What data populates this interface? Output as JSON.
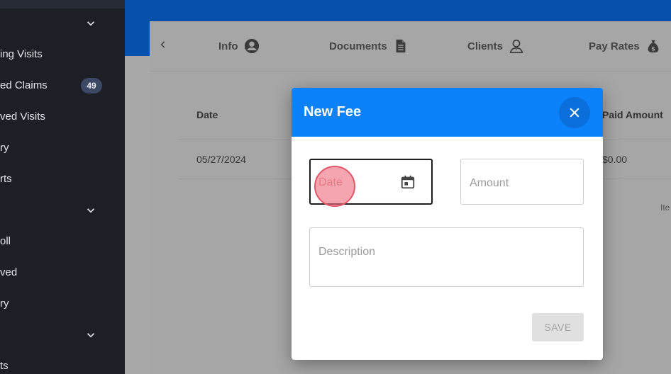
{
  "sidebar": {
    "items": [
      {
        "label": "ing Visits"
      },
      {
        "label": "ed Claims",
        "badge": "49"
      },
      {
        "label": "ved Visits"
      },
      {
        "label": "ry"
      },
      {
        "label": "rts"
      },
      {
        "label": "oll"
      },
      {
        "label": "ved"
      },
      {
        "label": "ry"
      },
      {
        "label": "ts"
      }
    ]
  },
  "tabs": [
    {
      "label": "Info",
      "icon": "account-circle-icon"
    },
    {
      "label": "Documents",
      "icon": "document-icon"
    },
    {
      "label": "Clients",
      "icon": "client-person-icon"
    },
    {
      "label": "Pay Rates",
      "icon": "money-bag-icon"
    }
  ],
  "table": {
    "headers": {
      "date": "Date",
      "paid_amount": "Paid Amount"
    },
    "rows": [
      {
        "date": "05/27/2024",
        "paid_amount": "$0.00"
      }
    ],
    "footer_text": "Ite"
  },
  "modal": {
    "title": "New Fee",
    "date_placeholder": "Date",
    "amount_placeholder": "Amount",
    "description_placeholder": "Description",
    "save_label": "SAVE"
  },
  "colors": {
    "sidebar_bg": "#1c1f26",
    "top_bar": "#0751ad",
    "modal_header": "#0b82fa",
    "click_indicator": "#e25768"
  }
}
